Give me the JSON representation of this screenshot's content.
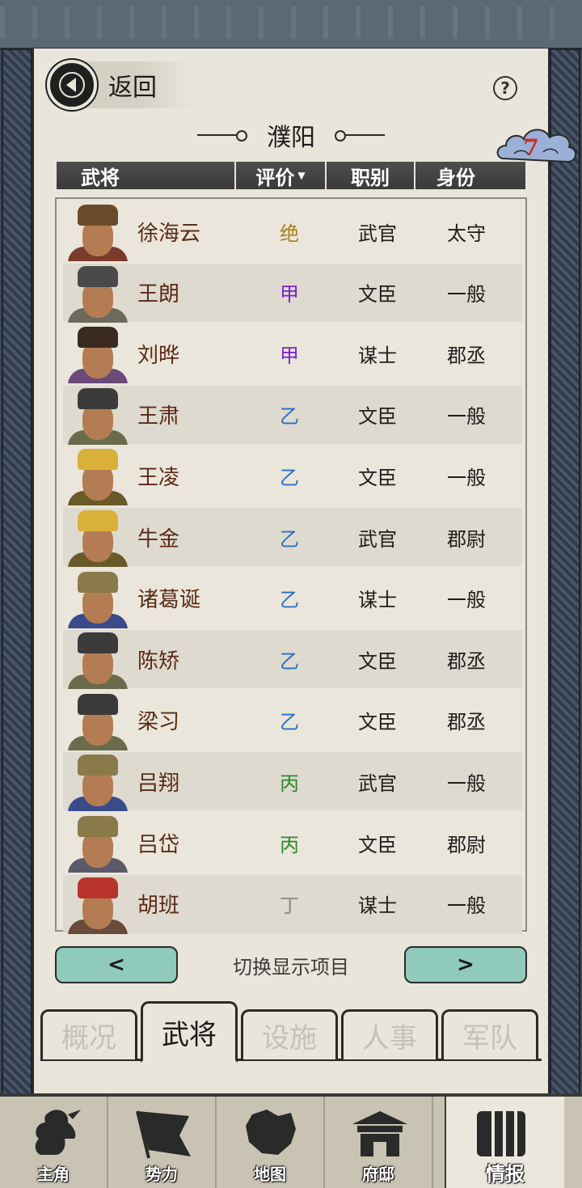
{
  "header": {
    "back_label": "返回",
    "help_icon": "?",
    "city_name": "濮阳",
    "count_badge": "7"
  },
  "table": {
    "columns": {
      "general": "武将",
      "rating": "评价",
      "position": "职别",
      "status": "身份"
    },
    "rows": [
      {
        "name": "徐海云",
        "rating": "绝",
        "rating_color": "#a67c1f",
        "position": "武官",
        "status": "太守"
      },
      {
        "name": "王朗",
        "rating": "甲",
        "rating_color": "#7a25c9",
        "position": "文臣",
        "status": "一般"
      },
      {
        "name": "刘晔",
        "rating": "甲",
        "rating_color": "#7a25c9",
        "position": "谋士",
        "status": "郡丞"
      },
      {
        "name": "王肃",
        "rating": "乙",
        "rating_color": "#2a6fc2",
        "position": "文臣",
        "status": "一般"
      },
      {
        "name": "王凌",
        "rating": "乙",
        "rating_color": "#2a6fc2",
        "position": "文臣",
        "status": "一般"
      },
      {
        "name": "牛金",
        "rating": "乙",
        "rating_color": "#2a6fc2",
        "position": "武官",
        "status": "郡尉"
      },
      {
        "name": "诸葛诞",
        "rating": "乙",
        "rating_color": "#2a6fc2",
        "position": "谋士",
        "status": "一般"
      },
      {
        "name": "陈矫",
        "rating": "乙",
        "rating_color": "#2a6fc2",
        "position": "文臣",
        "status": "郡丞"
      },
      {
        "name": "梁习",
        "rating": "乙",
        "rating_color": "#2a6fc2",
        "position": "文臣",
        "status": "郡丞"
      },
      {
        "name": "吕翔",
        "rating": "丙",
        "rating_color": "#2f8a2f",
        "position": "武官",
        "status": "一般"
      },
      {
        "name": "吕岱",
        "rating": "丙",
        "rating_color": "#2f8a2f",
        "position": "文臣",
        "status": "郡尉"
      },
      {
        "name": "胡班",
        "rating": "丁",
        "rating_color": "#8c8c8c",
        "position": "谋士",
        "status": "一般"
      }
    ]
  },
  "pager": {
    "prev_label": "<",
    "next_label": ">",
    "switch_label": "切换显示项目"
  },
  "tabs": [
    {
      "label": "概况",
      "active": false
    },
    {
      "label": "武将",
      "active": true
    },
    {
      "label": "设施",
      "active": false
    },
    {
      "label": "人事",
      "active": false
    },
    {
      "label": "军队",
      "active": false
    }
  ],
  "bottom_nav": [
    {
      "label": "主角",
      "icon": "warrior-icon"
    },
    {
      "label": "势力",
      "icon": "flag-icon"
    },
    {
      "label": "地图",
      "icon": "map-icon"
    },
    {
      "label": "府邸",
      "icon": "mansion-icon"
    },
    {
      "label": "情报",
      "icon": "scroll-icon",
      "active": true
    }
  ]
}
